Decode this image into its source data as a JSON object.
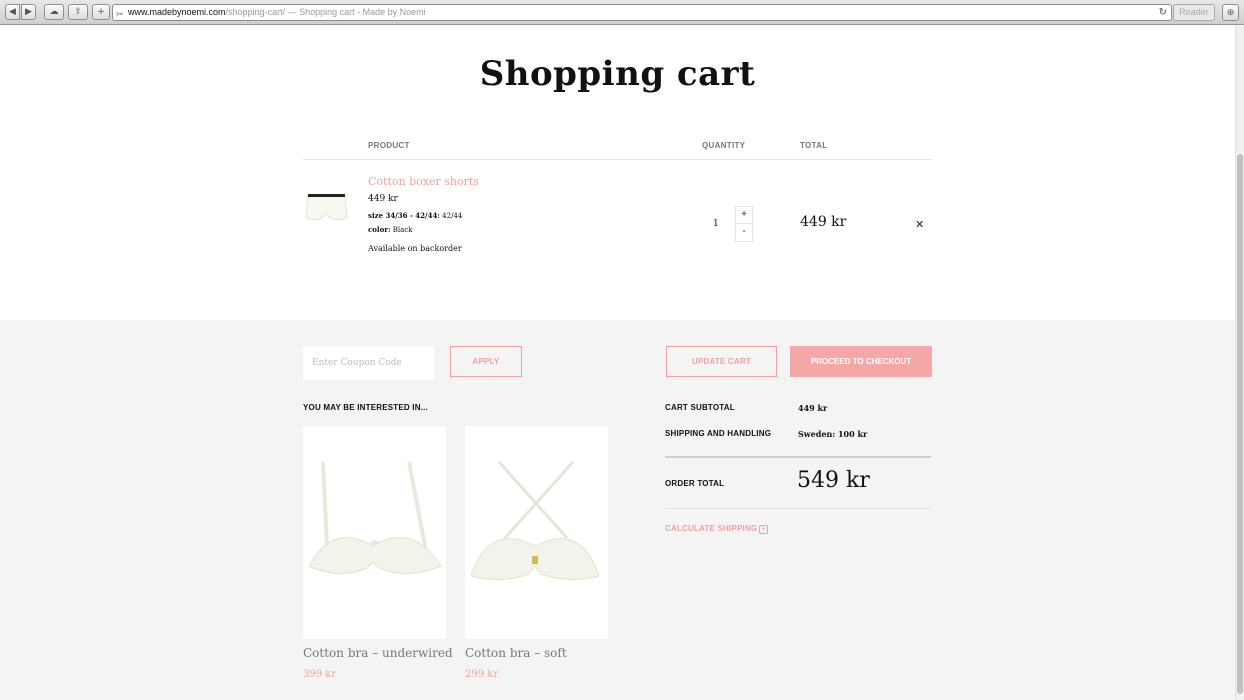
{
  "browser": {
    "url_domain": "www.madebynoemi.com",
    "url_path": "/shopping-cart/",
    "page_title_suffix": " — Shopping cart - Made by Noemi",
    "reader_label": "Reader"
  },
  "page": {
    "title": "Shopping cart"
  },
  "cart": {
    "columns": {
      "product": "PRODUCT",
      "quantity": "QUANTITY",
      "total": "TOTAL"
    },
    "item": {
      "name": "Cotton boxer shorts",
      "price": "449 kr",
      "size_label": "size 34/36 - 42/44:",
      "size_value": "42/44",
      "color_label": "color:",
      "color_value": "Black",
      "availability": "Available on backorder",
      "quantity": "1",
      "line_total": "449 kr"
    }
  },
  "actions": {
    "coupon_placeholder": "Enter Coupon Code",
    "apply": "APPLY",
    "update_cart": "UPDATE CART",
    "checkout": "PROCEED TO CHECKOUT"
  },
  "recommendations": {
    "heading": "YOU MAY BE INTERESTED IN...",
    "items": [
      {
        "name": "Cotton bra – underwired",
        "price": "399 kr"
      },
      {
        "name": "Cotton bra – soft",
        "price": "299 kr"
      }
    ]
  },
  "totals": {
    "subtotal_label": "CART SUBTOTAL",
    "subtotal_value": "449 kr",
    "shipping_label": "SHIPPING AND HANDLING",
    "shipping_value": "Sweden: 100 kr",
    "order_total_label": "ORDER TOTAL",
    "order_total_value": "549 kr",
    "calculate_shipping": "CALCULATE SHIPPING"
  },
  "colors": {
    "accent": "#f0a0a0",
    "checkout_bg": "#f5a7a7",
    "bg_grey": "#f4f4f4"
  }
}
